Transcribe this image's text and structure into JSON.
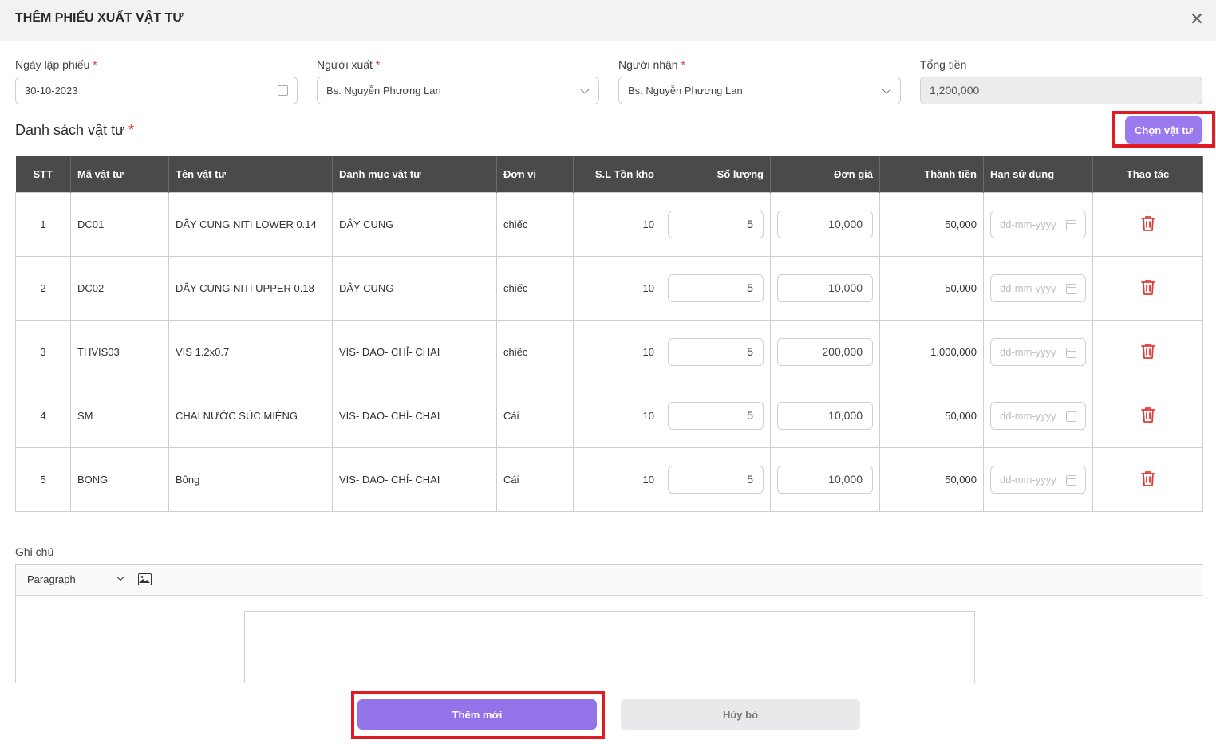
{
  "dialog": {
    "title": "THÊM PHIẾU XUẤT VẬT TƯ",
    "close_icon": "close-icon"
  },
  "form": {
    "date": {
      "label": "Ngày lập phiếu",
      "required": "*",
      "value": "30-10-2023"
    },
    "issuer": {
      "label": "Người xuất",
      "required": "*",
      "value": "Bs. Nguyễn Phương Lan"
    },
    "receiver": {
      "label": "Người nhận",
      "required": "*",
      "value": "Bs. Nguyễn Phương Lan"
    },
    "total": {
      "label": "Tổng tiền",
      "value": "1,200,000"
    }
  },
  "materials": {
    "title": "Danh sách vật tư",
    "required": "*",
    "pick_button": "Chọn vật tư",
    "columns": [
      "STT",
      "Mã vật tư",
      "Tên vật tư",
      "Danh mục vật tư",
      "Đơn vị",
      "S.L Tồn kho",
      "Số lượng",
      "Đơn giá",
      "Thành tiền",
      "Hạn sử dụng",
      "Thao tác"
    ],
    "date_placeholder": "dd-mm-yyyy",
    "rows": [
      {
        "stt": "1",
        "code": "DC01",
        "name": "DÂY CUNG NITI LOWER 0.14",
        "category": "DÂY CUNG",
        "unit": "chiếc",
        "stock": "10",
        "qty": "5",
        "price": "10,000",
        "amount": "50,000"
      },
      {
        "stt": "2",
        "code": "DC02",
        "name": "DÂY CUNG NITI UPPER 0.18",
        "category": "DÂY CUNG",
        "unit": "chiếc",
        "stock": "10",
        "qty": "5",
        "price": "10,000",
        "amount": "50,000"
      },
      {
        "stt": "3",
        "code": "THVIS03",
        "name": "VIS 1.2x0.7",
        "category": "VIS- DAO- CHỈ- CHAI",
        "unit": "chiếc",
        "stock": "10",
        "qty": "5",
        "price": "200,000",
        "amount": "1,000,000"
      },
      {
        "stt": "4",
        "code": "SM",
        "name": "CHAI NƯỚC SÚC MIỆNG",
        "category": "VIS- DAO- CHỈ- CHAI",
        "unit": "Cái",
        "stock": "10",
        "qty": "5",
        "price": "10,000",
        "amount": "50,000"
      },
      {
        "stt": "5",
        "code": "BONG",
        "name": "Bông",
        "category": "VIS- DAO- CHỈ- CHAI",
        "unit": "Cái",
        "stock": "10",
        "qty": "5",
        "price": "10,000",
        "amount": "50,000"
      }
    ]
  },
  "note": {
    "label": "Ghi chú",
    "format": "Paragraph"
  },
  "footer": {
    "add_button": "Thêm mới",
    "cancel_button": "Hủy bỏ"
  },
  "colors": {
    "accent": "#9b7af0",
    "highlight": "#e01b24",
    "header_row": "#4a4a4a",
    "delete": "#e53935"
  }
}
